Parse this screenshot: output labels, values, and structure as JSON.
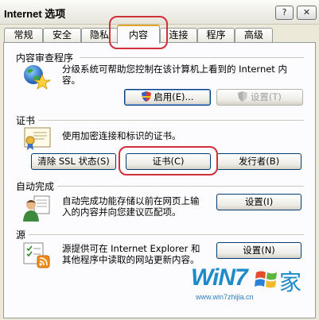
{
  "window": {
    "title": "Internet 选项",
    "help_glyph": "?",
    "close_glyph": "✕"
  },
  "tabs": [
    {
      "label": "常规"
    },
    {
      "label": "安全"
    },
    {
      "label": "隐私"
    },
    {
      "label": "内容"
    },
    {
      "label": "连接"
    },
    {
      "label": "程序"
    },
    {
      "label": "高级"
    }
  ],
  "sections": {
    "content_advisor": {
      "title": "内容审查程序",
      "description_1": "分级系统可帮助您控制在该计算机上看到的 Internet 内",
      "description_2": "容。",
      "enable_button": "启用(E)...",
      "settings_button": "设置(T)"
    },
    "certificates": {
      "title": "证书",
      "description": "使用加密连接和标识的证书。",
      "clear_ssl_button": "清除 SSL 状态(S)",
      "certificates_button": "证书(C)",
      "publishers_button": "发行者(B)"
    },
    "autocomplete": {
      "title": "自动完成",
      "description_1": "自动完成功能存储以前在网页上输",
      "description_2": "入的内容并向您建议匹配项。",
      "settings_button": "设置(I)"
    },
    "feeds": {
      "title": "源",
      "description_1": "源提供可在 Internet Explorer 和",
      "description_2": "其他程序中读取的网站更新内容。",
      "settings_button": "设置(N)"
    }
  },
  "watermark": {
    "brand_left": "WiN7",
    "brand_right": "家",
    "url": "www.win7zhijia.cn"
  },
  "colors": {
    "highlight_ring": "#d12f3c",
    "tab_active_border": "#e3a42c",
    "watermark": "#1e8ac8"
  }
}
